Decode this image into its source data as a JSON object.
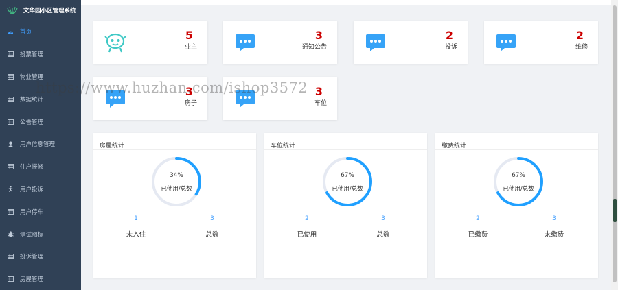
{
  "app": {
    "title": "文华园小区管理系统"
  },
  "sidebar": {
    "items": [
      {
        "label": "首页",
        "icon": "dashboard-icon",
        "active": true
      },
      {
        "label": "投票管理",
        "icon": "table-icon"
      },
      {
        "label": "物业管理",
        "icon": "table-icon"
      },
      {
        "label": "数据统计",
        "icon": "table-icon"
      },
      {
        "label": "公告管理",
        "icon": "table-icon"
      },
      {
        "label": "用户信息管理",
        "icon": "user-icon"
      },
      {
        "label": "住户报修",
        "icon": "table-icon"
      },
      {
        "label": "用户投诉",
        "icon": "accessibility-icon"
      },
      {
        "label": "用户停车",
        "icon": "table-icon"
      },
      {
        "label": "测试图标",
        "icon": "bug-icon"
      },
      {
        "label": "投诉管理",
        "icon": "table-icon"
      },
      {
        "label": "房屋管理",
        "icon": "table-icon"
      }
    ]
  },
  "stats": [
    {
      "value": "5",
      "label": "业主",
      "icon": "robot-icon"
    },
    {
      "value": "3",
      "label": "通知公告",
      "icon": "chat-bubble-icon"
    },
    {
      "value": "2",
      "label": "投诉",
      "icon": "chat-bubble-icon"
    },
    {
      "value": "2",
      "label": "维修",
      "icon": "chat-bubble-icon"
    },
    {
      "value": "3",
      "label": "房子",
      "icon": "chat-bubble-icon"
    },
    {
      "value": "3",
      "label": "车位",
      "icon": "chat-bubble-icon"
    }
  ],
  "panels": [
    {
      "title": "房屋统计",
      "percent": 34,
      "percent_text": "34%",
      "caption": "已使用/总数",
      "left_value": "1",
      "left_label": "未入住",
      "right_value": "3",
      "right_label": "总数"
    },
    {
      "title": "车位统计",
      "percent": 67,
      "percent_text": "67%",
      "caption": "已使用/总数",
      "left_value": "2",
      "left_label": "已使用",
      "right_value": "3",
      "right_label": "总数"
    },
    {
      "title": "缴费统计",
      "percent": 67,
      "percent_text": "67%",
      "caption": "已使用/总数",
      "left_value": "2",
      "left_label": "已缴费",
      "right_value": "3",
      "right_label": "未缴费"
    }
  ],
  "watermark": "https://www.huzhan.com/ishop3572",
  "colors": {
    "sidebar_bg": "#304156",
    "sidebar_text": "#bfcbd9",
    "accent": "#409eff",
    "stat_number": "#cc0000",
    "icon_blue": "#36a3f7",
    "icon_teal": "#40c9c6",
    "ring_track": "#e5e9f2",
    "ring_progress": "#20a0ff"
  }
}
